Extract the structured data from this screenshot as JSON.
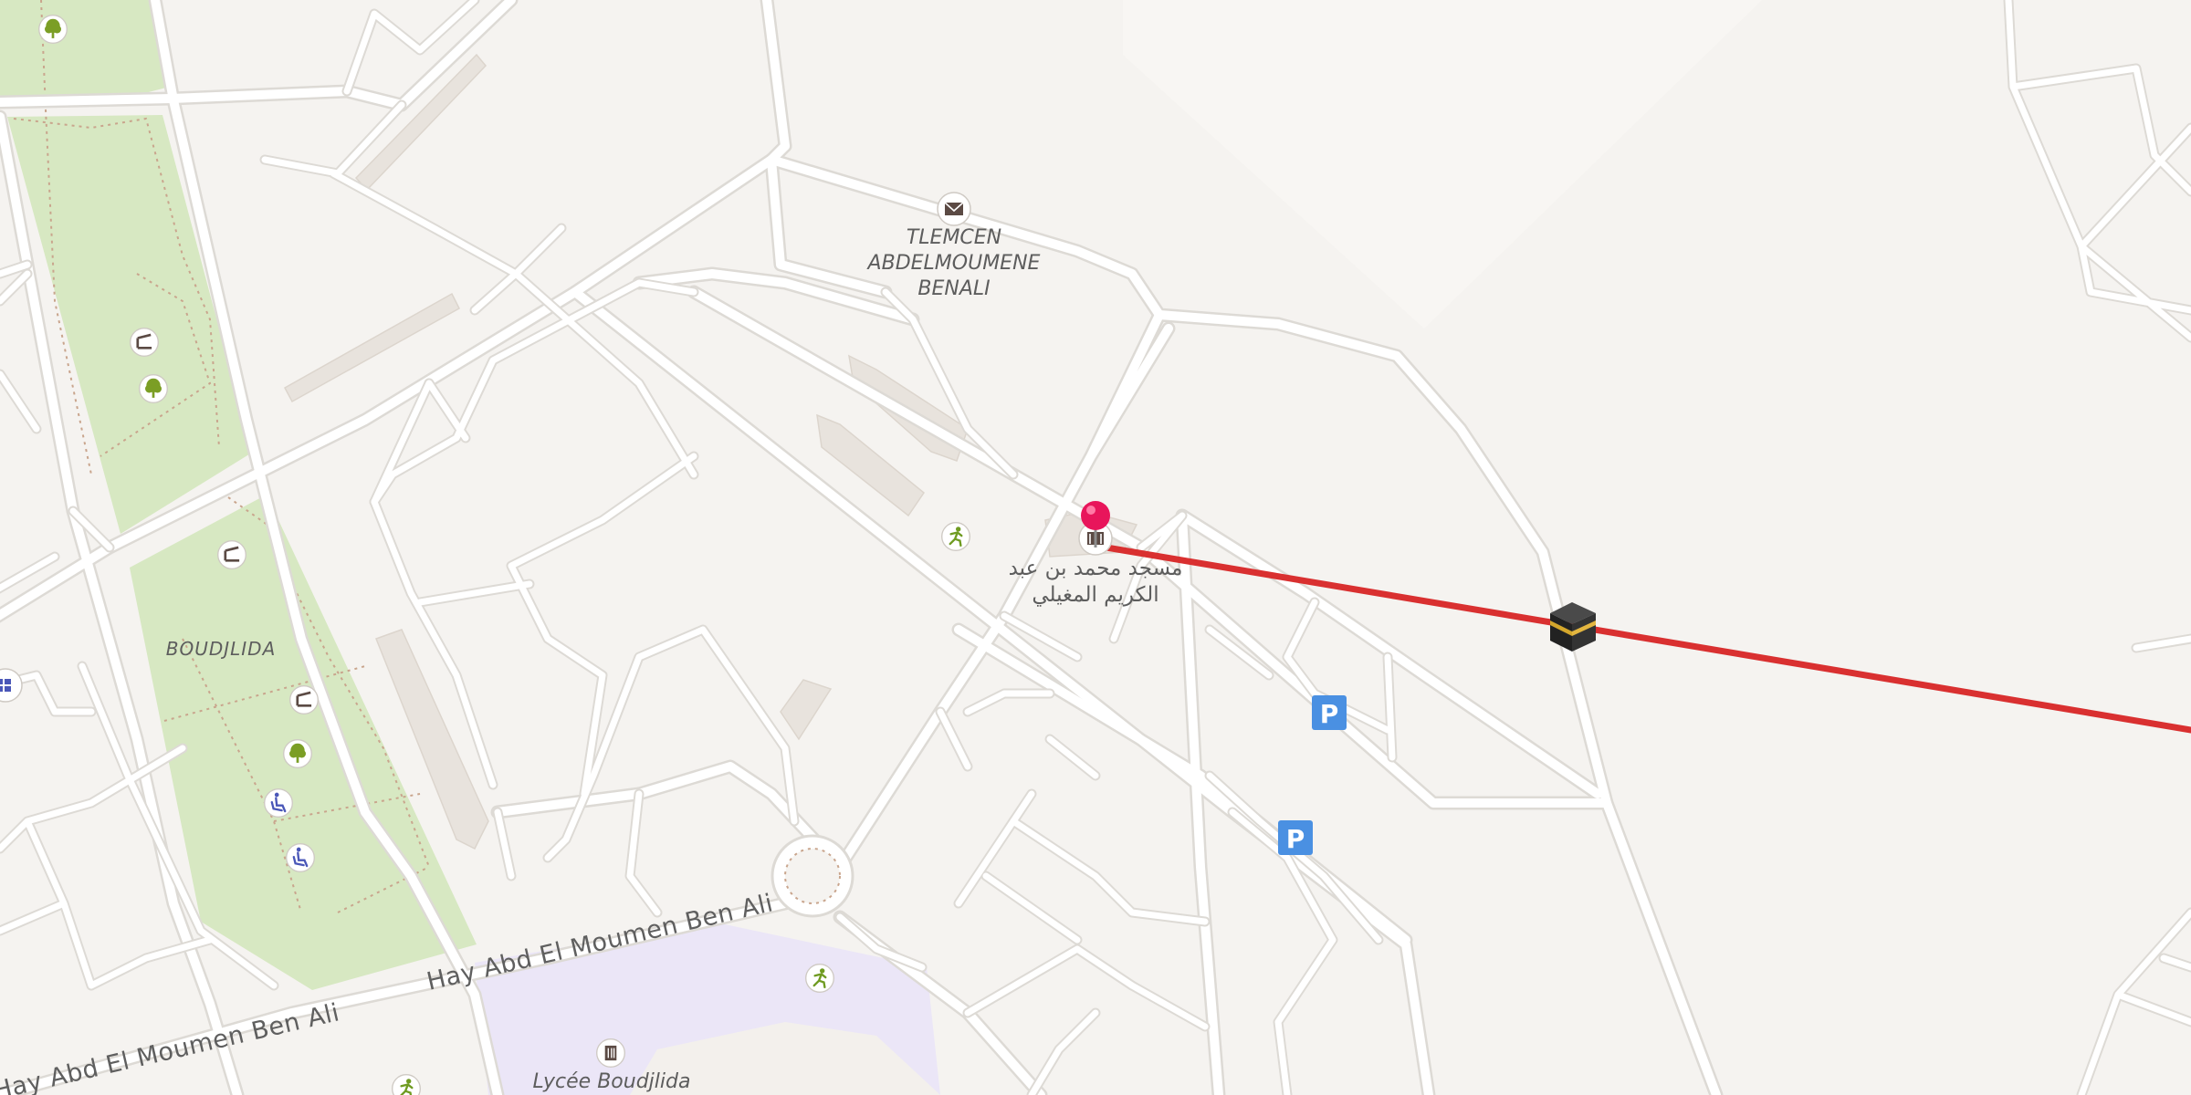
{
  "map": {
    "labels": {
      "post_office": [
        "TLEMCEN",
        "ABDELMOUMENE",
        "BENALI"
      ],
      "mosque": [
        "مسجد محمد بن عبد",
        "الكريم المغيلي"
      ],
      "park": "BOUDJLIDA",
      "school": "Lycée Boudjlida",
      "street_upper": "Hay Abd El Moumen Ben Ali",
      "street_lower": "Hay Abd El Moumen Ben Ali"
    },
    "parking_label": "P",
    "icons": {
      "tree": "tree-icon",
      "bench": "bench-icon",
      "post": "envelope-icon",
      "sport": "running-person-icon",
      "mosque": "mosque-icon",
      "school": "school-icon",
      "accessible": "wheelchair-icon",
      "parking": "parking-icon",
      "kaaba": "kaaba-icon",
      "pin": "location-pin-icon"
    },
    "colors": {
      "background": "#f5f3f0",
      "road": "#ffffff",
      "road_casing": "#dddad5",
      "park": "#d7e8c2",
      "school_area": "#ebe6f7",
      "building": "#e8e3dd",
      "qibla_line": "#d93030",
      "pin": "#e8155b",
      "parking": "#4a90e2",
      "icon_green": "#7b9e25"
    }
  }
}
